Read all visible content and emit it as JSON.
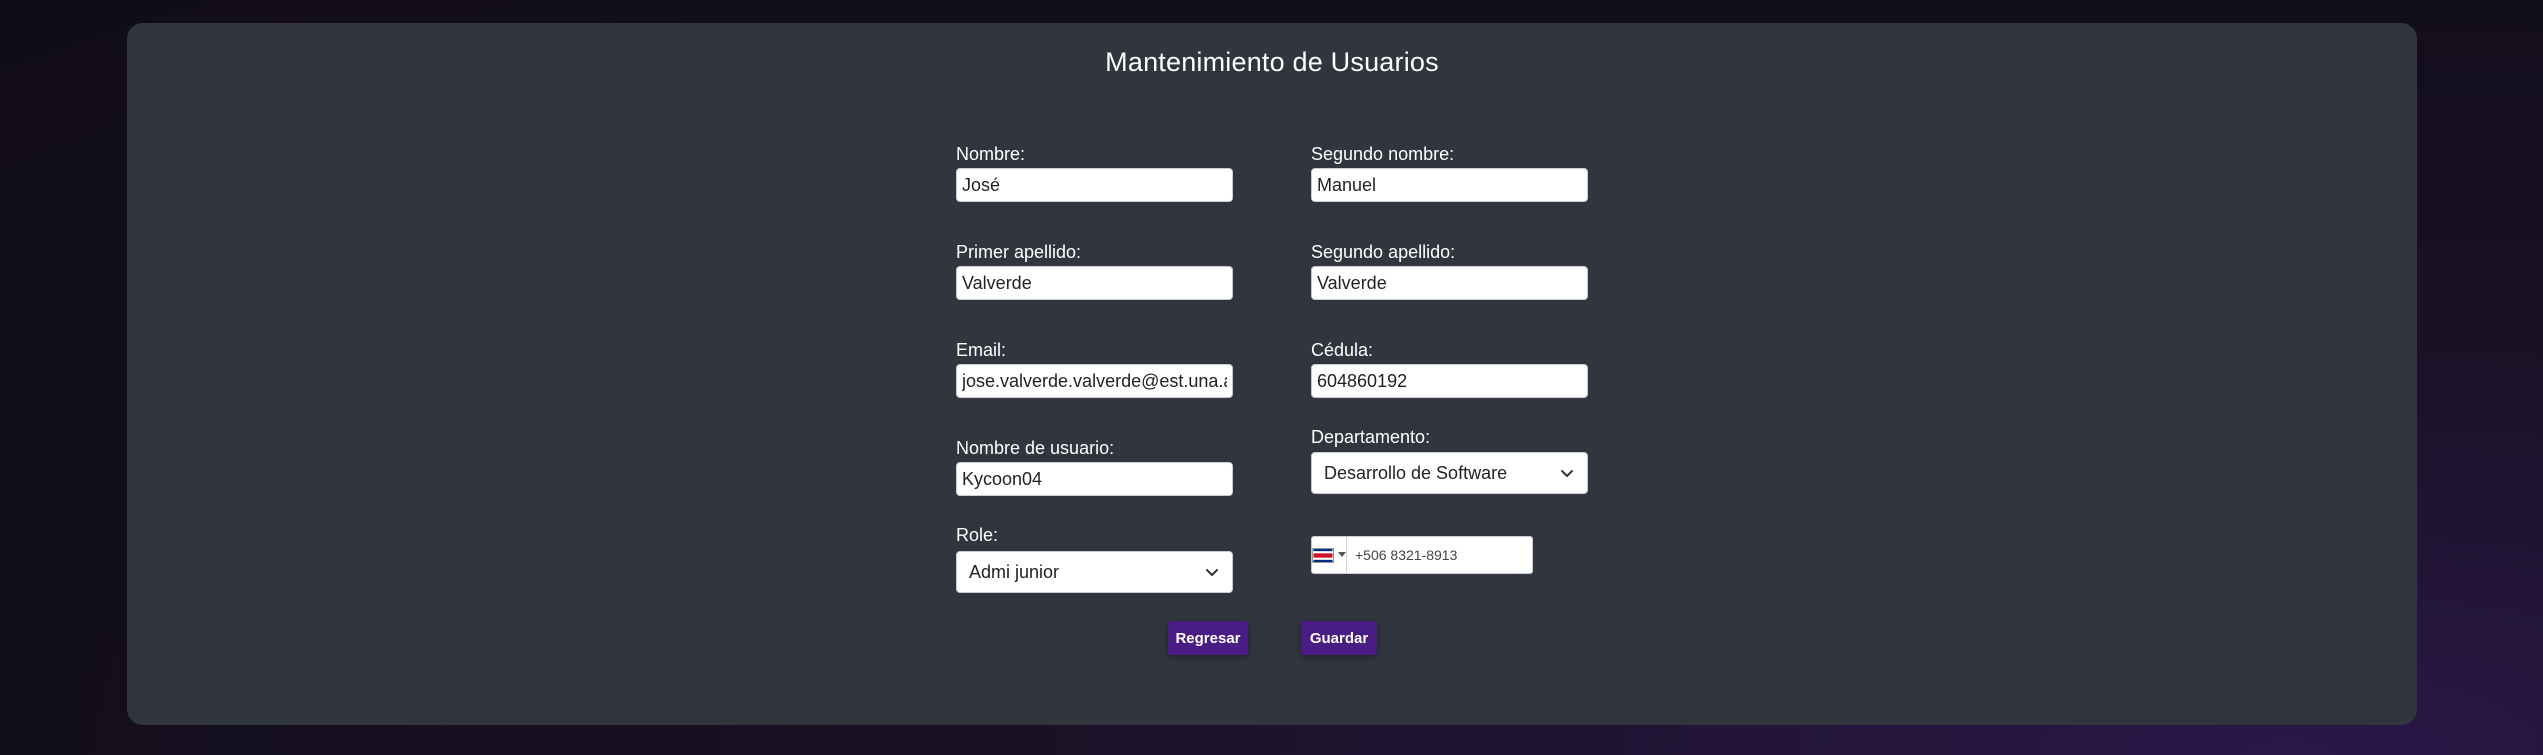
{
  "page": {
    "title": "Mantenimiento de Usuarios"
  },
  "form": {
    "nombre": {
      "label": "Nombre:",
      "value": "José"
    },
    "segundo_nombre": {
      "label": "Segundo nombre:",
      "value": "Manuel"
    },
    "primer_apellido": {
      "label": "Primer apellido:",
      "value": "Valverde"
    },
    "segundo_apellido": {
      "label": "Segundo apellido:",
      "value": "Valverde"
    },
    "email": {
      "label": "Email:",
      "value": "jose.valverde.valverde@est.una.ac.cr"
    },
    "cedula": {
      "label": "Cédula:",
      "value": "604860192"
    },
    "usuario": {
      "label": "Nombre de usuario:",
      "value": "Kycoon04"
    },
    "departamento": {
      "label": "Departamento:",
      "selected": "Desarrollo de Software"
    },
    "role": {
      "label": "Role:",
      "selected": "Admi junior"
    },
    "telefono": {
      "value": "+506 8321-8913",
      "country_flag": "costa-rica-flag-icon"
    }
  },
  "buttons": {
    "regresar": "Regresar",
    "guardar": "Guardar"
  },
  "colors": {
    "page_background": "#130e1c",
    "card_background": "#31353d",
    "button_background": "#4a1d84",
    "text": "#ffffff"
  }
}
